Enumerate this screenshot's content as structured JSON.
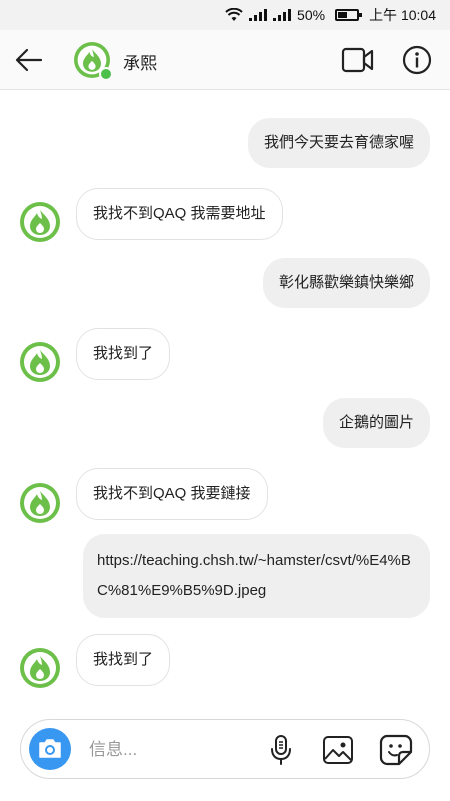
{
  "status_bar": {
    "battery": "50%",
    "time": "上午 10:04"
  },
  "header": {
    "contact_name": "承熙"
  },
  "messages": [
    {
      "direction": "outgoing",
      "text": "我們今天要去育德家喔"
    },
    {
      "direction": "incoming",
      "text": "我找不到QAQ 我需要地址"
    },
    {
      "direction": "outgoing",
      "text": "彰化縣歡樂鎮快樂鄉"
    },
    {
      "direction": "incoming",
      "text": "我找到了"
    },
    {
      "direction": "outgoing",
      "text": "企鵝的圖片"
    },
    {
      "direction": "incoming",
      "text": "我找不到QAQ 我要鏈接"
    },
    {
      "direction": "incoming",
      "text": "https://teaching.chsh.tw/~hamster/csvt/%E4%BC%81%E9%B5%9D.jpeg"
    },
    {
      "direction": "incoming",
      "text": "我找到了"
    }
  ],
  "composer": {
    "placeholder": "信息..."
  },
  "colors": {
    "avatar_green": "#6cc04a",
    "camera_blue": "#3897f0",
    "bubble_gray": "#efefef"
  }
}
